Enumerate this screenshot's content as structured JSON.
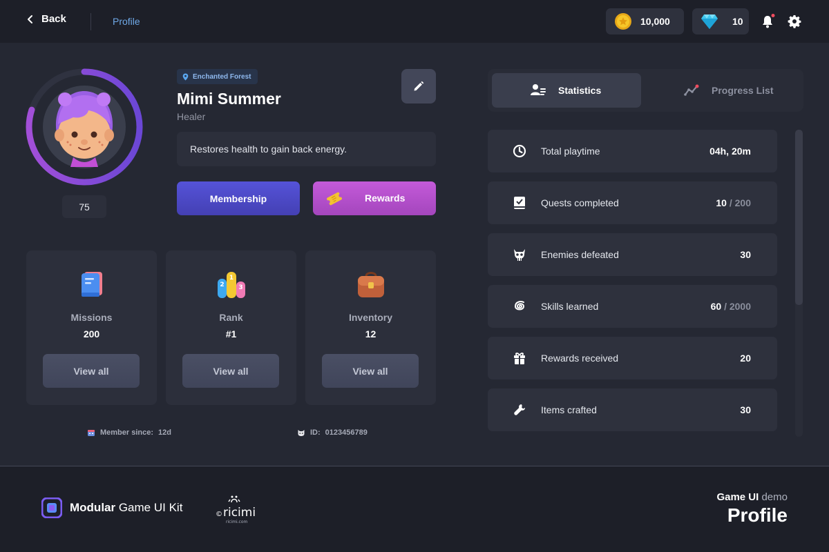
{
  "header": {
    "back_label": "Back",
    "breadcrumb": "Profile",
    "coins": "10,000",
    "gems": "10"
  },
  "profile": {
    "location": "Enchanted Forest",
    "name": "Mimi Summer",
    "role": "Healer",
    "level": "75",
    "level_progress": 0.8,
    "description": "Restores health to gain back energy.",
    "membership_label": "Membership",
    "rewards_label": "Rewards"
  },
  "cards": [
    {
      "title": "Missions",
      "value": "200",
      "button": "View all"
    },
    {
      "title": "Rank",
      "value": "#1",
      "button": "View all"
    },
    {
      "title": "Inventory",
      "value": "12",
      "button": "View all"
    }
  ],
  "meta": {
    "member_since_label": "Member since:",
    "member_since_value": "12d",
    "id_label": "ID:",
    "id_value": "0123456789"
  },
  "tabs": [
    {
      "label": "Statistics",
      "active": true
    },
    {
      "label": "Progress List",
      "active": false
    }
  ],
  "stats": [
    {
      "label": "Total playtime",
      "value": "04h, 20m",
      "total": "",
      "icon": "clock-icon"
    },
    {
      "label": "Quests completed",
      "value": "10",
      "total": "/ 200",
      "icon": "book-icon"
    },
    {
      "label": "Enemies defeated",
      "value": "30",
      "total": "",
      "icon": "skull-icon"
    },
    {
      "label": "Skills learned",
      "value": "60",
      "total": "/ 2000",
      "icon": "spiral-icon"
    },
    {
      "label": "Rewards received",
      "value": "20",
      "total": "",
      "icon": "gift-icon"
    },
    {
      "label": "Items crafted",
      "value": "30",
      "total": "",
      "icon": "wrench-icon"
    }
  ],
  "footer": {
    "brand_bold": "Modular",
    "brand_rest": " Game UI Kit",
    "ricimi": "ricimi",
    "ricimi_url": "ricimi.com",
    "demo_bold": "Game UI",
    "demo_rest": " demo",
    "demo_title": "Profile"
  },
  "colors": {
    "background": "#252833",
    "membership": "#4d4ac8",
    "rewards": "#b44fcc",
    "accent_link": "#6fa9e8",
    "ring": "#8e4fd6"
  }
}
